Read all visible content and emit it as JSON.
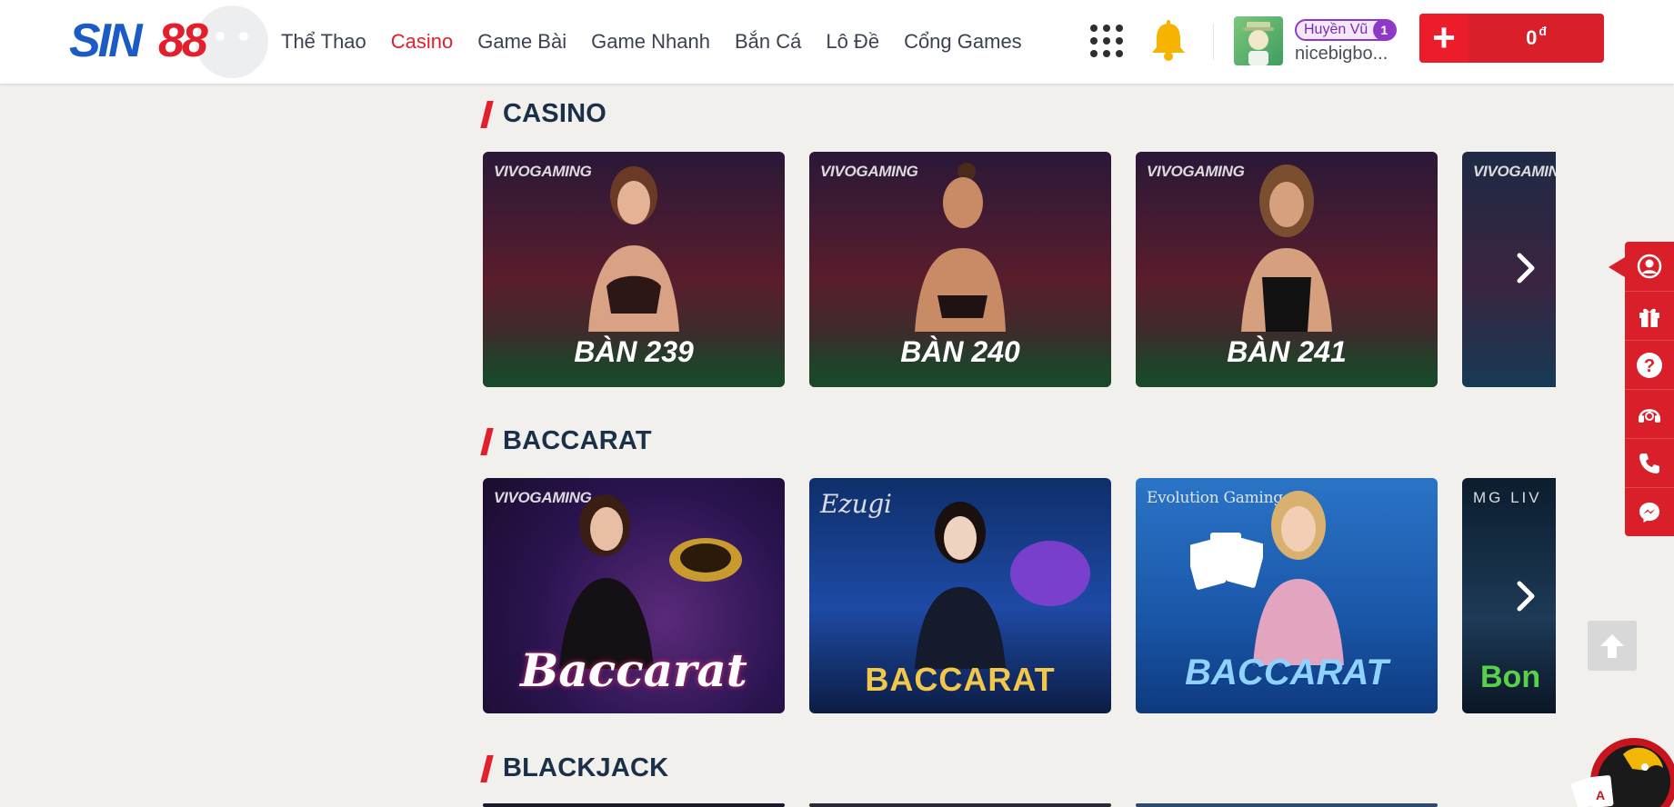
{
  "header": {
    "logo_text": "SIN88",
    "nav": [
      {
        "label": "Thể Thao",
        "active": false
      },
      {
        "label": "Casino",
        "active": true
      },
      {
        "label": "Game Bài",
        "active": false
      },
      {
        "label": "Game Nhanh",
        "active": false
      },
      {
        "label": "Bắn Cá",
        "active": false
      },
      {
        "label": "Lô Đề",
        "active": false
      },
      {
        "label": "Cổng Games",
        "active": false
      }
    ],
    "icons": {
      "apps": "grid-dots-icon",
      "notifications": "bell-icon"
    },
    "user": {
      "display_name": "Huyền Vũ",
      "level": "1",
      "username": "nicebigbo..."
    },
    "wallet": {
      "add_label": "+",
      "balance": "0",
      "currency": "đ"
    }
  },
  "sections": [
    {
      "title": "CASINO",
      "cards": [
        {
          "brand": "VIVOGAMING",
          "label": "BÀN 239"
        },
        {
          "brand": "VIVOGAMING",
          "label": "BÀN 240"
        },
        {
          "brand": "VIVOGAMING",
          "label": "BÀN 241"
        },
        {
          "brand": "VIVOGAMING",
          "label": ""
        }
      ]
    },
    {
      "title": "BACCARAT",
      "cards": [
        {
          "brand": "VIVOGAMING",
          "label": "Baccarat"
        },
        {
          "brand": "Ezugi",
          "label": "BACCARAT"
        },
        {
          "brand": "Evolution Gaming",
          "label": "BACCARAT"
        },
        {
          "brand": "MG LIV",
          "label": "Bon"
        }
      ]
    },
    {
      "title": "BLACKJACK",
      "cards": []
    }
  ],
  "side_bar": {
    "icons": [
      "user-circle-icon",
      "gift-icon",
      "help-icon",
      "support-headset-icon",
      "phone-icon",
      "messenger-icon"
    ]
  },
  "colors": {
    "brand_red": "#e21f2b",
    "brand_blue": "#1c5bc4",
    "title_navy": "#1a2f48",
    "page_bg": "#f1f0ed"
  }
}
